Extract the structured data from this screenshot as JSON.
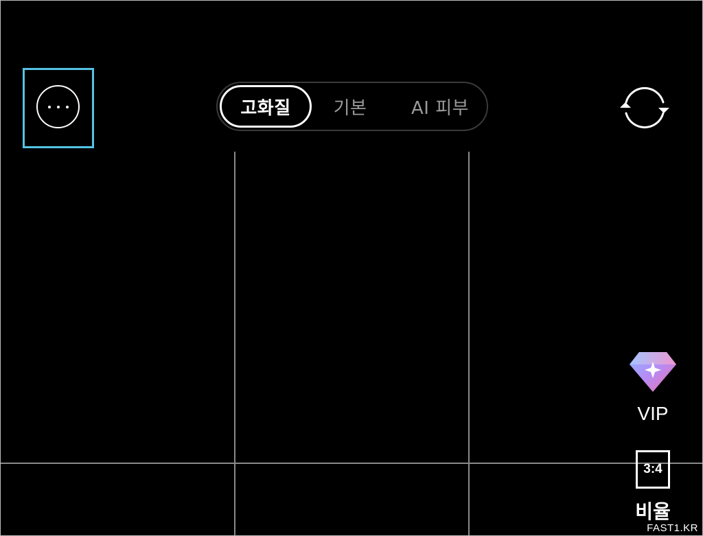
{
  "toolbar": {
    "more_icon": "more-horizontal-icon",
    "switch_camera_icon": "switch-camera-icon"
  },
  "mode_tabs": [
    {
      "label": "고화질",
      "selected": true
    },
    {
      "label": "기본",
      "selected": false
    },
    {
      "label": "AI 피부",
      "selected": false
    }
  ],
  "side_tools": {
    "vip": {
      "label": "VIP",
      "icon": "diamond-sparkle-icon"
    },
    "ratio": {
      "label": "비율",
      "icon_text": "3:4"
    }
  },
  "watermark": "FAST1.KR",
  "colors": {
    "background": "#000000",
    "highlight": "#55c3e4",
    "inactive_text": "#9a9a9a",
    "grid_line": "#8a8a8a"
  }
}
